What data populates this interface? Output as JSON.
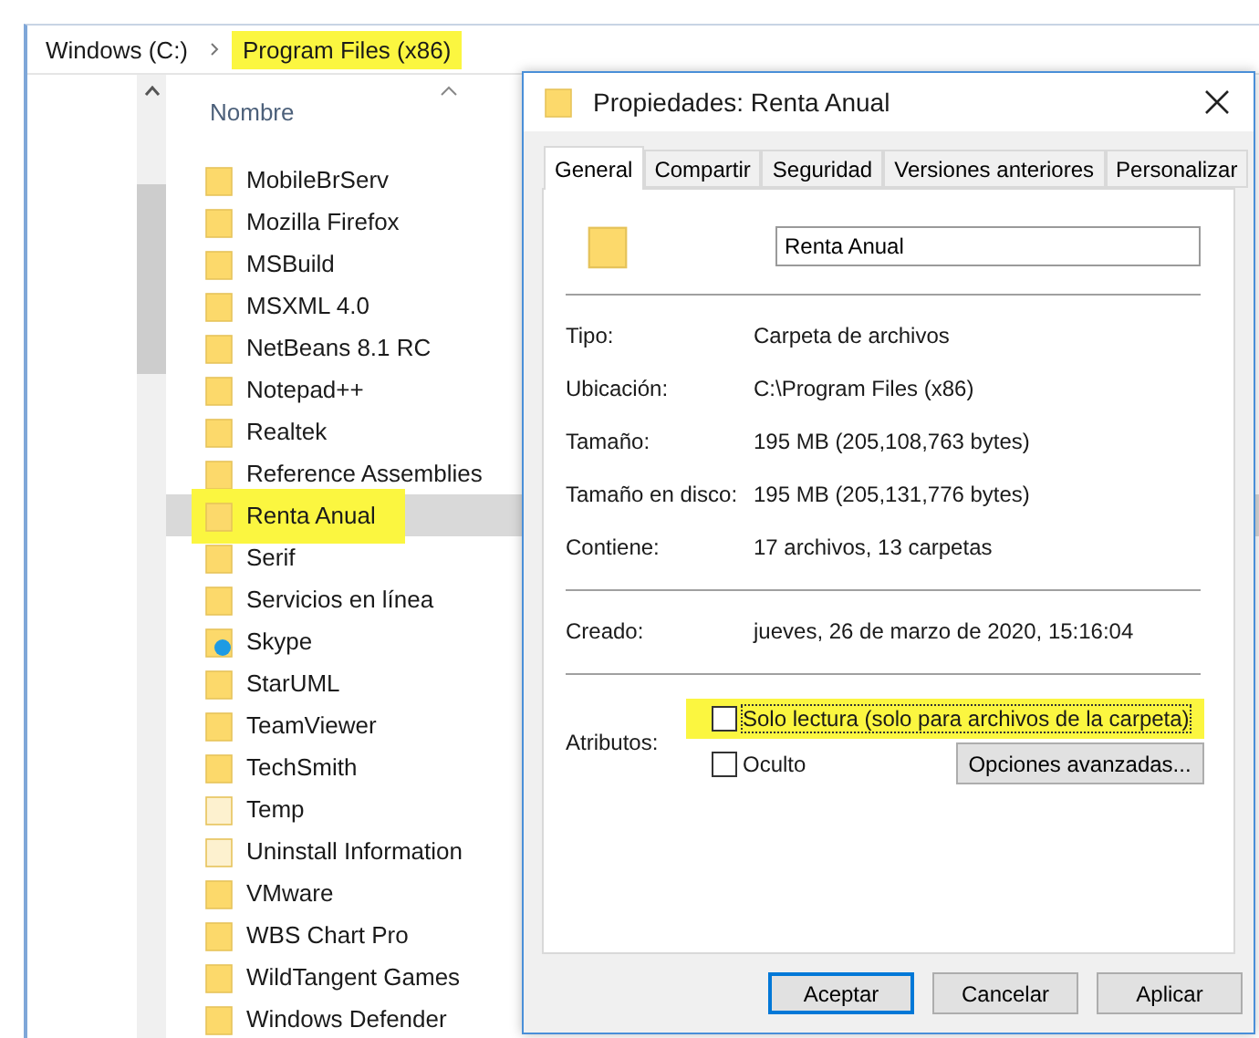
{
  "address_bar": {
    "crumbs": [
      {
        "label": "Windows (C:)",
        "highlighted": false
      },
      {
        "label": "Program Files (x86)",
        "highlighted": true
      }
    ]
  },
  "file_list": {
    "column": "Nombre",
    "items": [
      {
        "name": "MobileBrServ",
        "kind": "folder",
        "selected": false,
        "highlighted": false
      },
      {
        "name": "Mozilla Firefox",
        "kind": "folder",
        "selected": false,
        "highlighted": false
      },
      {
        "name": "MSBuild",
        "kind": "folder",
        "selected": false,
        "highlighted": false
      },
      {
        "name": "MSXML 4.0",
        "kind": "folder",
        "selected": false,
        "highlighted": false
      },
      {
        "name": "NetBeans 8.1 RC",
        "kind": "folder",
        "selected": false,
        "highlighted": false
      },
      {
        "name": "Notepad++",
        "kind": "folder",
        "selected": false,
        "highlighted": false
      },
      {
        "name": "Realtek",
        "kind": "folder",
        "selected": false,
        "highlighted": false
      },
      {
        "name": "Reference Assemblies",
        "kind": "folder",
        "selected": false,
        "highlighted": false
      },
      {
        "name": "Renta Anual",
        "kind": "folder",
        "selected": true,
        "highlighted": true
      },
      {
        "name": "Serif",
        "kind": "folder",
        "selected": false,
        "highlighted": false
      },
      {
        "name": "Servicios en línea",
        "kind": "folder",
        "selected": false,
        "highlighted": false
      },
      {
        "name": "Skype",
        "kind": "app-folder",
        "selected": false,
        "highlighted": false
      },
      {
        "name": "StarUML",
        "kind": "folder",
        "selected": false,
        "highlighted": false
      },
      {
        "name": "TeamViewer",
        "kind": "folder",
        "selected": false,
        "highlighted": false
      },
      {
        "name": "TechSmith",
        "kind": "folder",
        "selected": false,
        "highlighted": false
      },
      {
        "name": "Temp",
        "kind": "hidden-folder",
        "selected": false,
        "highlighted": false
      },
      {
        "name": "Uninstall Information",
        "kind": "hidden-folder",
        "selected": false,
        "highlighted": false
      },
      {
        "name": "VMware",
        "kind": "folder",
        "selected": false,
        "highlighted": false
      },
      {
        "name": "WBS Chart Pro",
        "kind": "folder",
        "selected": false,
        "highlighted": false
      },
      {
        "name": "WildTangent Games",
        "kind": "folder",
        "selected": false,
        "highlighted": false
      },
      {
        "name": "Windows Defender",
        "kind": "folder",
        "selected": false,
        "highlighted": false
      }
    ]
  },
  "dialog": {
    "title": "Propiedades: Renta Anual",
    "tabs": [
      {
        "label": "General",
        "selected": true
      },
      {
        "label": "Compartir",
        "selected": false
      },
      {
        "label": "Seguridad",
        "selected": false
      },
      {
        "label": "Versiones anteriores",
        "selected": false
      },
      {
        "label": "Personalizar",
        "selected": false
      }
    ],
    "name_field": {
      "value": "Renta Anual"
    },
    "details": [
      {
        "label": "Tipo:",
        "value": "Carpeta de archivos"
      },
      {
        "label": "Ubicación:",
        "value": "C:\\Program Files (x86)"
      },
      {
        "label": "Tamaño:",
        "value": "195 MB (205,108,763 bytes)"
      },
      {
        "label": "Tamaño en disco:",
        "value": "195 MB (205,131,776 bytes)"
      },
      {
        "label": "Contiene:",
        "value": "17 archivos, 13 carpetas"
      }
    ],
    "created": {
      "label": "Creado:",
      "value": "jueves, 26 de marzo de 2020, 15:16:04"
    },
    "attributes": {
      "label": "Atributos:",
      "options": [
        {
          "label": "Solo lectura (solo para archivos de la carpeta)",
          "checked": false,
          "focused": true,
          "highlighted": true
        },
        {
          "label": "Oculto",
          "checked": false,
          "focused": false,
          "highlighted": false
        }
      ],
      "advanced_button": "Opciones avanzadas..."
    },
    "buttons": [
      {
        "label": "Aceptar",
        "default": true
      },
      {
        "label": "Cancelar",
        "default": false
      },
      {
        "label": "Aplicar",
        "default": false
      }
    ]
  }
}
